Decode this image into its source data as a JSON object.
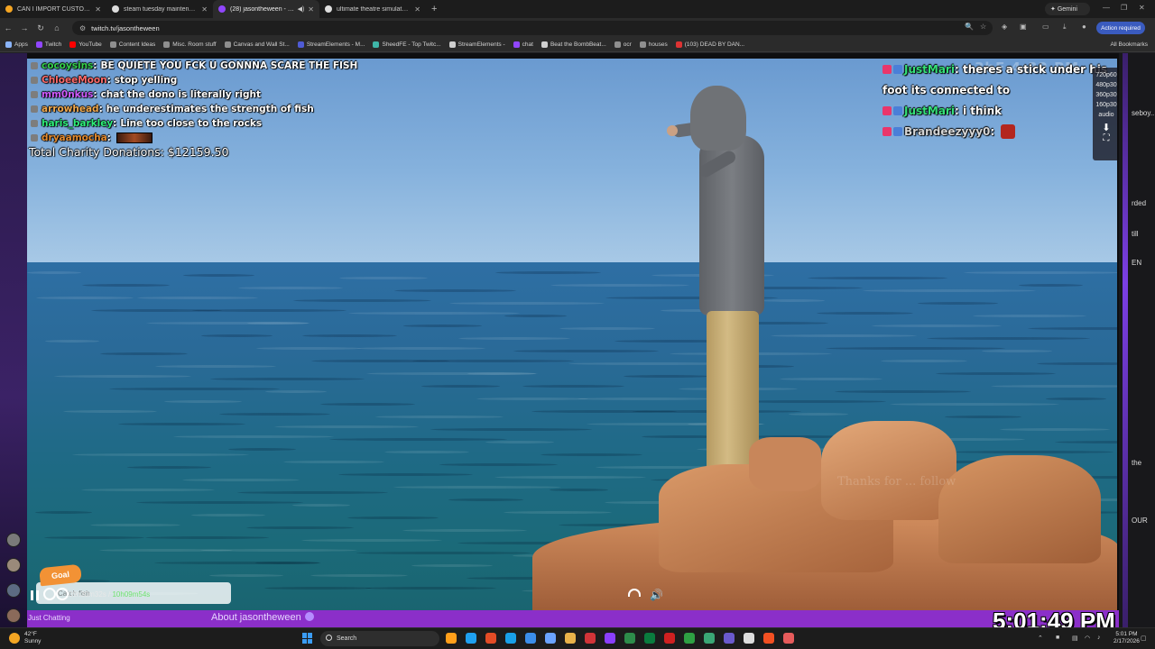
{
  "browser": {
    "tabs": [
      {
        "title": "CAN I IMPORT CUSTOM MOVIES",
        "color": "#f5a623",
        "active": false
      },
      {
        "title": "steam tuesday maintenance - G",
        "color": "#dddddd",
        "active": false
      },
      {
        "title": "(28) jasontheween - Twitch",
        "color": "#9146ff",
        "active": true
      },
      {
        "title": "ultimate theatre simulator i am",
        "color": "#dddddd",
        "active": false
      }
    ],
    "gemini_label": "Gemini",
    "url": "twitch.tv/jasontheween",
    "action_required": "Action required",
    "bookmarks": [
      {
        "label": "Apps",
        "color": "#8ab4f8"
      },
      {
        "label": "Twitch",
        "color": "#9146ff"
      },
      {
        "label": "YouTube",
        "color": "#ff0000"
      },
      {
        "label": "Content Ideas",
        "color": "#8f8f8f"
      },
      {
        "label": "Misc. Room stuff",
        "color": "#8f8f8f"
      },
      {
        "label": "Canvas and Wall St...",
        "color": "#8f8f8f"
      },
      {
        "label": "StreamElements - M...",
        "color": "#4f5bd5"
      },
      {
        "label": "SheedFE - Top Twitc...",
        "color": "#3fb6a8"
      },
      {
        "label": "StreamElements -",
        "color": "#cfcfcf"
      },
      {
        "label": "chat",
        "color": "#9146ff"
      },
      {
        "label": "Beat the BombBeat...",
        "color": "#cfcfcf"
      },
      {
        "label": "ocr",
        "color": "#8f8f8f"
      },
      {
        "label": "houses",
        "color": "#8f8f8f"
      },
      {
        "label": "(103) DEAD BY DAN...",
        "color": "#d33"
      }
    ],
    "all_bookmarks": "All Bookmarks"
  },
  "overlay_chat": [
    {
      "user": "cocoysins",
      "user_color": "#35d04b",
      "message": "BE QUIETE YOU FCK U GONNNA SCARE THE FISH"
    },
    {
      "user": "ChloeeMoon",
      "user_color": "#ff6b6b",
      "message": "stop yelling"
    },
    {
      "user": "mm0nkus",
      "user_color": "#d05bff",
      "message": "chat the dono is literally right"
    },
    {
      "user": "arrowhead",
      "user_color": "#f1a94e",
      "message": "he underestimates the strength of fish"
    },
    {
      "user": "haris_barkley",
      "user_color": "#2ef07a",
      "message": "Line too close to the rocks"
    },
    {
      "user": "dryaamocha",
      "user_color": "#e38a2e",
      "message": ""
    }
  ],
  "charity": "Total Charity Donations: $12159.50",
  "overlay_chat_right": [
    {
      "user": "JustMari",
      "user_color": "#35e078",
      "message": "theres a stick under his"
    },
    {
      "user": "",
      "user_color": "#ffffff",
      "message": "foot its connected to"
    },
    {
      "user": "JustMari",
      "user_color": "#35e078",
      "message": "i think"
    },
    {
      "user": "Brandeezyyy0",
      "user_color": "#d6d6d6",
      "message": ""
    }
  ],
  "ghost_timer": "3hF 4:32 PM",
  "quality_options": [
    "720p60",
    "480p30",
    "360p30",
    "160p30",
    "audio"
  ],
  "thanks_text": "Thanks for ... follow",
  "goal": {
    "tag": "Goal",
    "text": "Catch fish"
  },
  "player": {
    "elapsed": "09h30m32s",
    "total": "10h09m54s"
  },
  "category": "Just Chatting",
  "about": "About jasontheween",
  "stream_clock": "5:01:49 PM",
  "right_panel_text": [
    "seboy...",
    "rded",
    "till",
    "EN",
    "the",
    "OUR"
  ],
  "taskbar": {
    "temp": "42°F",
    "condition": "Sunny",
    "search": "Search",
    "time": "5:01 PM",
    "date": "2/17/2026",
    "apps": [
      "#ff9f1a",
      "#1fa0f0",
      "#e34c26",
      "#19a0e8",
      "#3b8eea",
      "#6aa3ff",
      "#e8b24a",
      "#d13438",
      "#8a3ffc",
      "#2d8c4a",
      "#0a7c3e",
      "#cf2020",
      "#2ea043",
      "#3aa675",
      "#6a5acd",
      "#dddddd",
      "#f25022",
      "#e65b5b"
    ]
  }
}
